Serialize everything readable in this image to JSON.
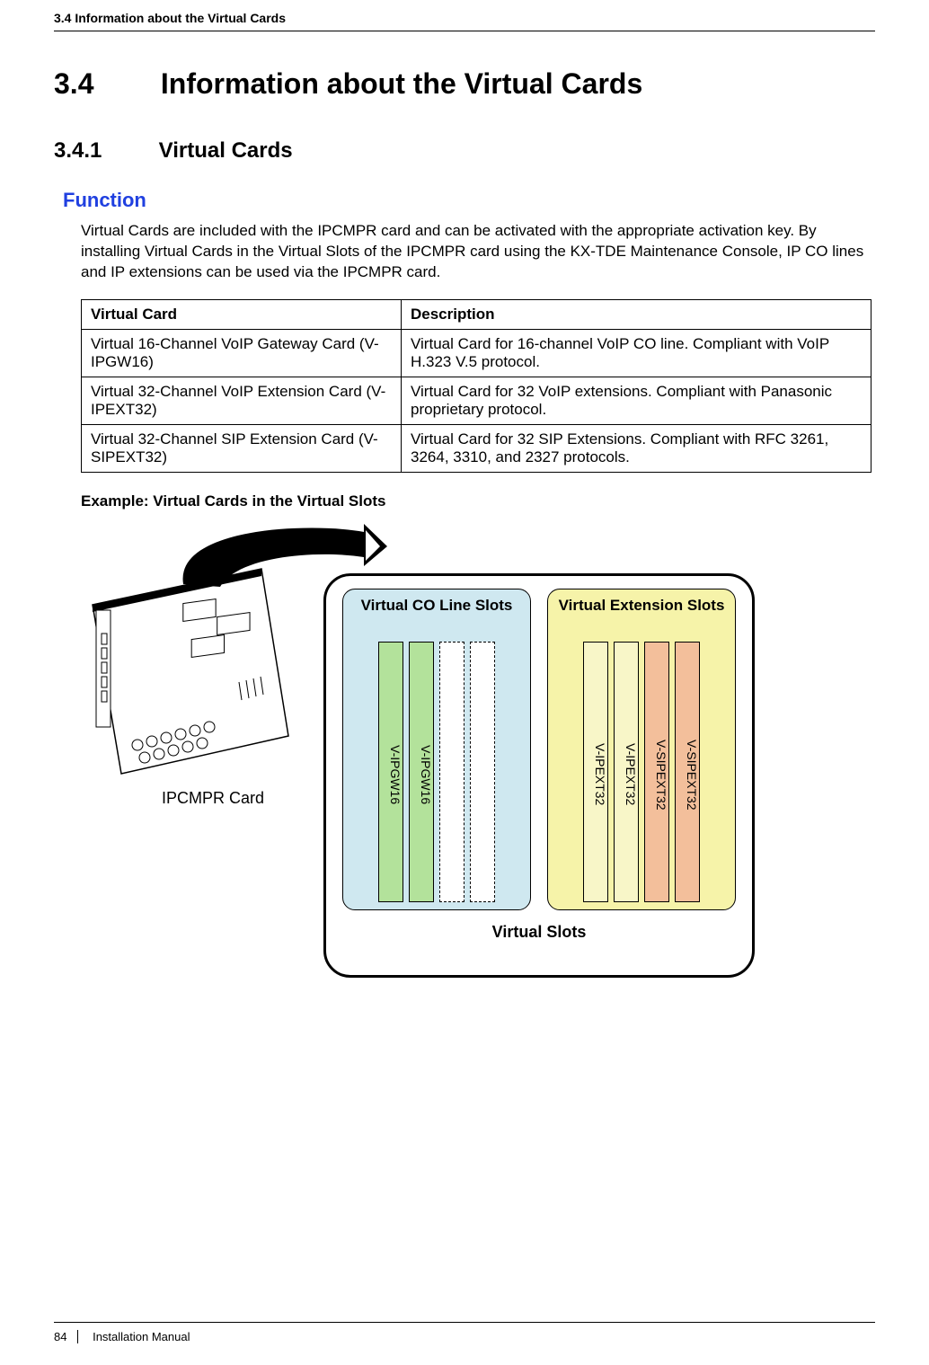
{
  "header": {
    "running": "3.4 Information about the Virtual Cards"
  },
  "section": {
    "num": "3.4",
    "title": "Information about the Virtual Cards"
  },
  "subsection": {
    "num": "3.4.1",
    "title": "Virtual Cards"
  },
  "function": {
    "label": "Function",
    "intro": "Virtual Cards are included with the IPCMPR card and can be activated with the appropriate activation key. By installing Virtual Cards in the Virtual Slots of the IPCMPR card using the KX-TDE Maintenance Console, IP CO lines and IP extensions can be used via the IPCMPR card."
  },
  "table": {
    "headers": [
      "Virtual Card",
      "Description"
    ],
    "rows": [
      {
        "card": "Virtual 16-Channel VoIP Gateway Card (V-IPGW16)",
        "desc": "Virtual Card for 16-channel VoIP CO line. Compliant with VoIP H.323 V.5 protocol."
      },
      {
        "card": "Virtual 32-Channel VoIP Extension Card (V-IPEXT32)",
        "desc": "Virtual Card for 32 VoIP extensions. Compliant with Panasonic proprietary protocol."
      },
      {
        "card": "Virtual 32-Channel SIP Extension Card (V-SIPEXT32)",
        "desc": "Virtual Card for 32 SIP Extensions. Compliant with RFC 3261, 3264, 3310, and 2327 protocols."
      }
    ]
  },
  "example_heading": "Example: Virtual Cards in the Virtual Slots",
  "diagram": {
    "ipcmpr_label": "IPCMPR Card",
    "virtual_slots_caption": "Virtual Slots",
    "co_group_title": "Virtual CO Line Slots",
    "ext_group_title": "Virtual Extension Slots",
    "co_cards": [
      "V-IPGW16",
      "V-IPGW16"
    ],
    "ext_cards": [
      "V-IPEXT32",
      "V-IPEXT32",
      "V-SIPEXT32",
      "V-SIPEXT32"
    ]
  },
  "footer": {
    "page_number": "84",
    "doc_title": "Installation Manual"
  }
}
